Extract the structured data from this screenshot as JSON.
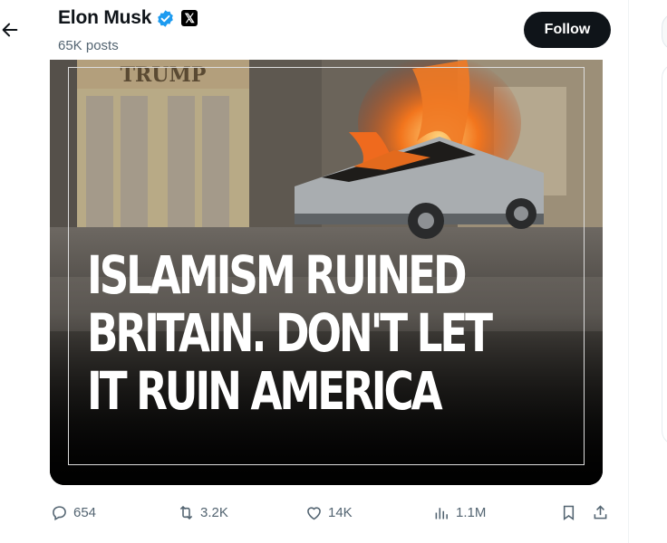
{
  "header": {
    "name": "Elon Musk",
    "posts": "65K posts",
    "affiliation_badge": "𝕏",
    "follow_label": "Follow"
  },
  "media": {
    "storefront_sign": "TRUMP",
    "headline_lines": [
      "ISLAMISM RUINED",
      "BRITAIN. DON'T LET",
      "IT RUIN AMERICA"
    ]
  },
  "actions": {
    "replies": "654",
    "reposts": "3.2K",
    "likes": "14K",
    "views": "1.1M"
  },
  "colors": {
    "verified_blue": "#1d9bf0",
    "follow_bg": "#0f1419",
    "muted_text": "#536471"
  },
  "icons": [
    "back-arrow-icon",
    "verified-badge-icon",
    "x-logo-icon",
    "reply-icon",
    "repost-icon",
    "like-icon",
    "views-icon",
    "bookmark-icon",
    "share-icon"
  ]
}
